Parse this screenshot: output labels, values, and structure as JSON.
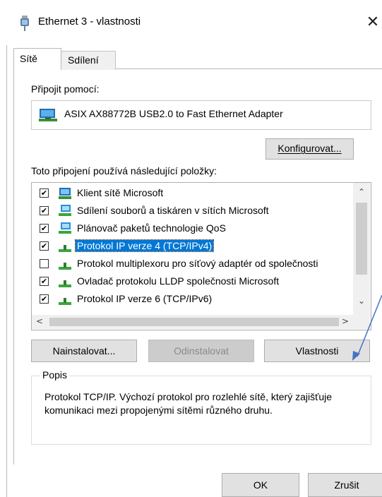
{
  "window": {
    "title": "Ethernet 3 - vlastnosti",
    "close_glyph": "✕"
  },
  "tabs": [
    {
      "label": "Sítě",
      "active": true
    },
    {
      "label": "Sdílení",
      "active": false
    }
  ],
  "connect_using": {
    "label": "Připojit pomocí:",
    "adapter": "ASIX AX88772B USB2.0 to Fast Ethernet Adapter",
    "icon": "network-adapter-icon"
  },
  "configure_button": "Konfigurovat...",
  "items_label": "Toto připojení používá následující položky:",
  "items": [
    {
      "label": "Klient sítě Microsoft",
      "checked": true,
      "selected": false,
      "icon": "network-client-icon"
    },
    {
      "label": "Sdílení souborů a tiskáren v sítích Microsoft",
      "checked": true,
      "selected": false,
      "icon": "network-service-icon"
    },
    {
      "label": "Plánovač paketů technologie QoS",
      "checked": true,
      "selected": false,
      "icon": "network-service-icon"
    },
    {
      "label": "Protokol IP verze 4 (TCP/IPv4)",
      "checked": true,
      "selected": true,
      "icon": "protocol-icon"
    },
    {
      "label": "Protokol multiplexoru pro síťový adaptér od společnosti",
      "checked": false,
      "selected": false,
      "icon": "protocol-icon"
    },
    {
      "label": "Ovladač protokolu LLDP společnosti Microsoft",
      "checked": true,
      "selected": false,
      "icon": "protocol-icon"
    },
    {
      "label": "Protokol IP verze 6 (TCP/IPv6)",
      "checked": true,
      "selected": false,
      "icon": "protocol-icon"
    }
  ],
  "buttons": {
    "install": "Nainstalovat...",
    "uninstall": "Odinstalovat",
    "properties": "Vlastnosti",
    "ok": "OK",
    "cancel": "Zrušit"
  },
  "description": {
    "legend": "Popis",
    "text": "Protokol TCP/IP. Výchozí protokol pro rozlehlé sítě, který zajišťuje komunikaci mezi propojenými sítěmi různého druhu."
  },
  "colors": {
    "selection": "#0078d7",
    "annotation_arrow": "#4472c4"
  }
}
